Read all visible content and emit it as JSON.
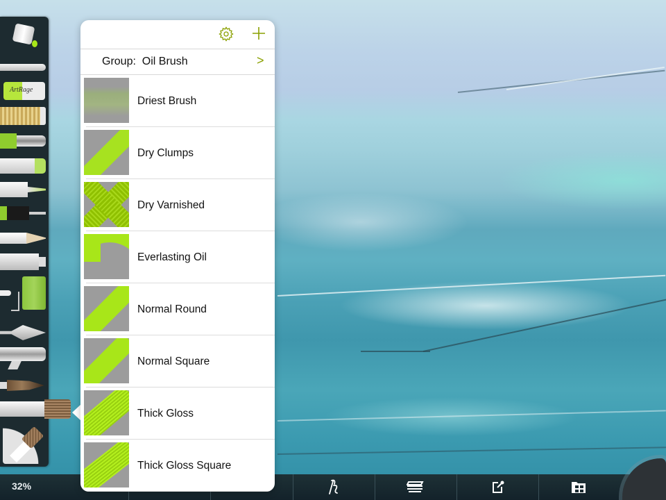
{
  "app": {
    "zoom_level": "32%"
  },
  "colors": {
    "accent": "#8aa000",
    "brush_green": "#a8e619",
    "thumb_gray": "#9c9c9c",
    "palette_bg": "#1d2b30"
  },
  "toolbar_left": {
    "tools": [
      {
        "name": "paint-bucket-icon"
      },
      {
        "name": "glitter-tube-icon"
      },
      {
        "name": "eraser-icon",
        "label": "ArtRage"
      },
      {
        "name": "glitter-icon"
      },
      {
        "name": "airbrush-pen-icon"
      },
      {
        "name": "chalk-icon"
      },
      {
        "name": "felt-pen-icon"
      },
      {
        "name": "inking-pen-icon"
      },
      {
        "name": "pencil-icon"
      },
      {
        "name": "paint-tube-icon"
      },
      {
        "name": "paint-roller-icon"
      },
      {
        "name": "palette-knife-icon"
      },
      {
        "name": "airbrush-icon"
      },
      {
        "name": "watercolor-brush-icon"
      },
      {
        "name": "oil-brush-icon",
        "selected": true
      }
    ],
    "current_tool": "oil-brush-icon"
  },
  "popover": {
    "settings_icon": "gear-icon",
    "add_icon": "plus-icon",
    "group_label": "Group:  Oil Brush",
    "group_chevron": ">",
    "presets": [
      {
        "label": "Driest Brush",
        "thumb": "driest"
      },
      {
        "label": "Dry Clumps",
        "thumb": "clumps"
      },
      {
        "label": "Dry Varnished",
        "thumb": "varnished"
      },
      {
        "label": "Everlasting Oil",
        "thumb": "everlasting"
      },
      {
        "label": "Normal Round",
        "thumb": "round"
      },
      {
        "label": "Normal Square",
        "thumb": "square"
      },
      {
        "label": "Thick Gloss",
        "thumb": "gloss"
      },
      {
        "label": "Thick Gloss Square",
        "thumb": "gloss-square"
      }
    ]
  },
  "bottom_bar": {
    "buttons": [
      {
        "name": "tool-settings-icon"
      },
      {
        "name": "layers-icon"
      },
      {
        "name": "share-icon"
      },
      {
        "name": "gallery-icon"
      }
    ],
    "color_picker": "color-picker-corner"
  }
}
